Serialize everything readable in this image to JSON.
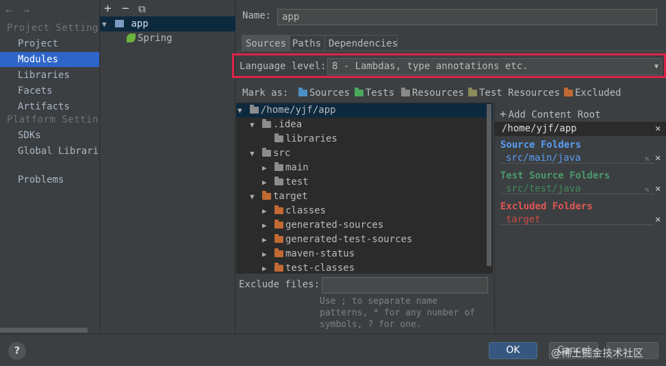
{
  "nav": {
    "back": "←",
    "forward": "→",
    "section_project": "Project Settings",
    "project_items": [
      "Project",
      "Modules",
      "Libraries",
      "Facets",
      "Artifacts"
    ],
    "section_platform": "Platform Settings",
    "platform_items": [
      "SDKs",
      "Global Libraries"
    ],
    "problems": "Problems"
  },
  "module_tree": {
    "add": "+",
    "remove": "−",
    "copy": "⧉",
    "module": "app",
    "facet": "Spring"
  },
  "name": {
    "label": "Name:",
    "value": "app"
  },
  "tabs": [
    "Sources",
    "Paths",
    "Dependencies"
  ],
  "language_level": {
    "label": "Language level:",
    "value": "8 - Lambdas, type annotations etc."
  },
  "mark_as": {
    "label": "Mark as:",
    "options": [
      {
        "label": "Sources",
        "color": "#4a90c8"
      },
      {
        "label": "Tests",
        "color": "#4aa85a"
      },
      {
        "label": "Resources",
        "color": "#8a8a8a"
      },
      {
        "label": "Test Resources",
        "color": "#8a8a5a"
      },
      {
        "label": "Excluded",
        "color": "#c26a34"
      }
    ]
  },
  "file_tree": {
    "root": "/home/yjf/app",
    "idea": ".idea",
    "libraries": "libraries",
    "src": "src",
    "main": "main",
    "test": "test",
    "target": "target",
    "classes": "classes",
    "generated_sources": "generated-sources",
    "generated_test_sources": "generated-test-sources",
    "maven_status": "maven-status",
    "test_classes": "test-classes"
  },
  "exclude": {
    "label": "Exclude files:",
    "value": "",
    "hint": [
      "Use ; to separate name",
      "patterns, * for any number of",
      "symbols, ? for one."
    ]
  },
  "content_roots": {
    "add": "Add Content Root",
    "root": "/home/yjf/app",
    "source_header": "Source Folders",
    "source_path": "src/main/java",
    "test_header": "Test Source Folders",
    "test_path": "src/test/java",
    "excluded_header": "Excluded Folders",
    "excluded_path": "target",
    "colors": {
      "source": "#589df6",
      "test": "#4a9a6a",
      "excluded": "#e05555"
    }
  },
  "buttons": {
    "ok": "OK",
    "cancel": "Cancel",
    "help": "?"
  },
  "watermark": "@稀土掘金技术社区"
}
